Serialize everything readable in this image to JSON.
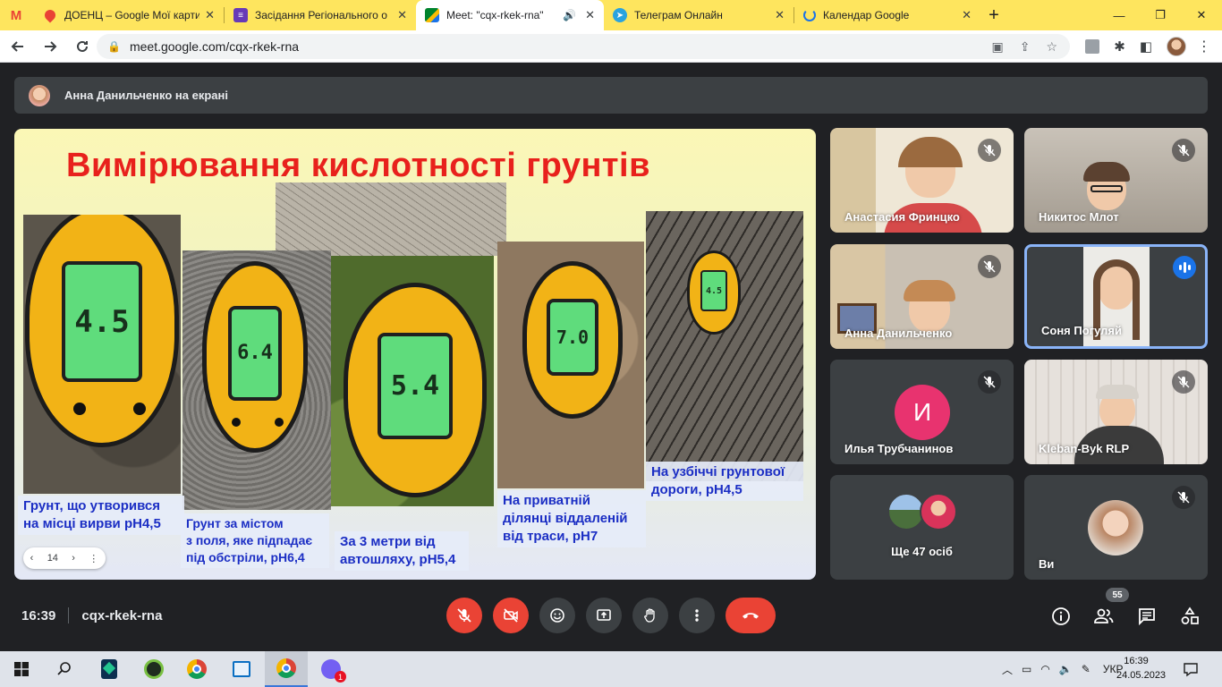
{
  "browser": {
    "tabs": [
      {
        "title": "",
        "icon": "gmail-icon",
        "color": "#ea4335"
      },
      {
        "title": "ДОЕНЦ – Google Мої карти",
        "icon": "maps-icon",
        "color": "#e94235"
      },
      {
        "title": "Засідання Регіонального о",
        "icon": "forms-icon",
        "color": "#673ab7"
      },
      {
        "title": "Meet: \"cqx-rkek-rna\"",
        "icon": "meet-icon",
        "color": "#00832d"
      },
      {
        "title": "Телеграм Онлайн",
        "icon": "telegram-icon",
        "color": "#2aa3df"
      },
      {
        "title": "Календар Google",
        "icon": "loading-icon",
        "color": "#1a73e8"
      }
    ],
    "url": "meet.google.com/cqx-rkek-rna",
    "window_controls": {
      "minimize": "—",
      "restore": "❐",
      "close": "✕"
    }
  },
  "meet": {
    "presenting_banner": "Анна Данильченко на екрані",
    "slide": {
      "title": "Вимірювання кислотності грунтів",
      "readings": [
        "4.5",
        "6.4",
        "5.4",
        "7.0",
        "4.5"
      ],
      "captions": [
        "Грунт, що утворився\n на місці вирви  pH4,5",
        "Грунт за містом\nз поля, яке підпадає\nпід обстріли, pH6,4",
        "За 3 метри від\nавтошляху, pH5,4",
        "На приватній\nділянці віддаленій\n від траси, рН7",
        "На узбіччі грунтової\nдороги, рН4,5"
      ],
      "page_number": "14"
    },
    "participants": [
      {
        "name": "Анастасия Фринцко",
        "muted": true
      },
      {
        "name": "Никитос Млот",
        "muted": true
      },
      {
        "name": "Анна Данильченко",
        "muted": true
      },
      {
        "name": "Соня Погуляй",
        "muted": false,
        "speaking": true
      },
      {
        "name": "Илья Трубчанинов",
        "muted": true,
        "initial": "И"
      },
      {
        "name": "Kleban-Byk RLP",
        "muted": true
      },
      {
        "name": "Ще 47 осіб",
        "muted": false
      },
      {
        "name": "Ви",
        "muted": true
      }
    ],
    "time": "16:39",
    "meeting_code": "cqx-rkek-rna",
    "participant_count": "55"
  },
  "taskbar": {
    "language": "УКР",
    "time": "16:39",
    "date": "24.05.2023",
    "viber_badge": "1"
  }
}
